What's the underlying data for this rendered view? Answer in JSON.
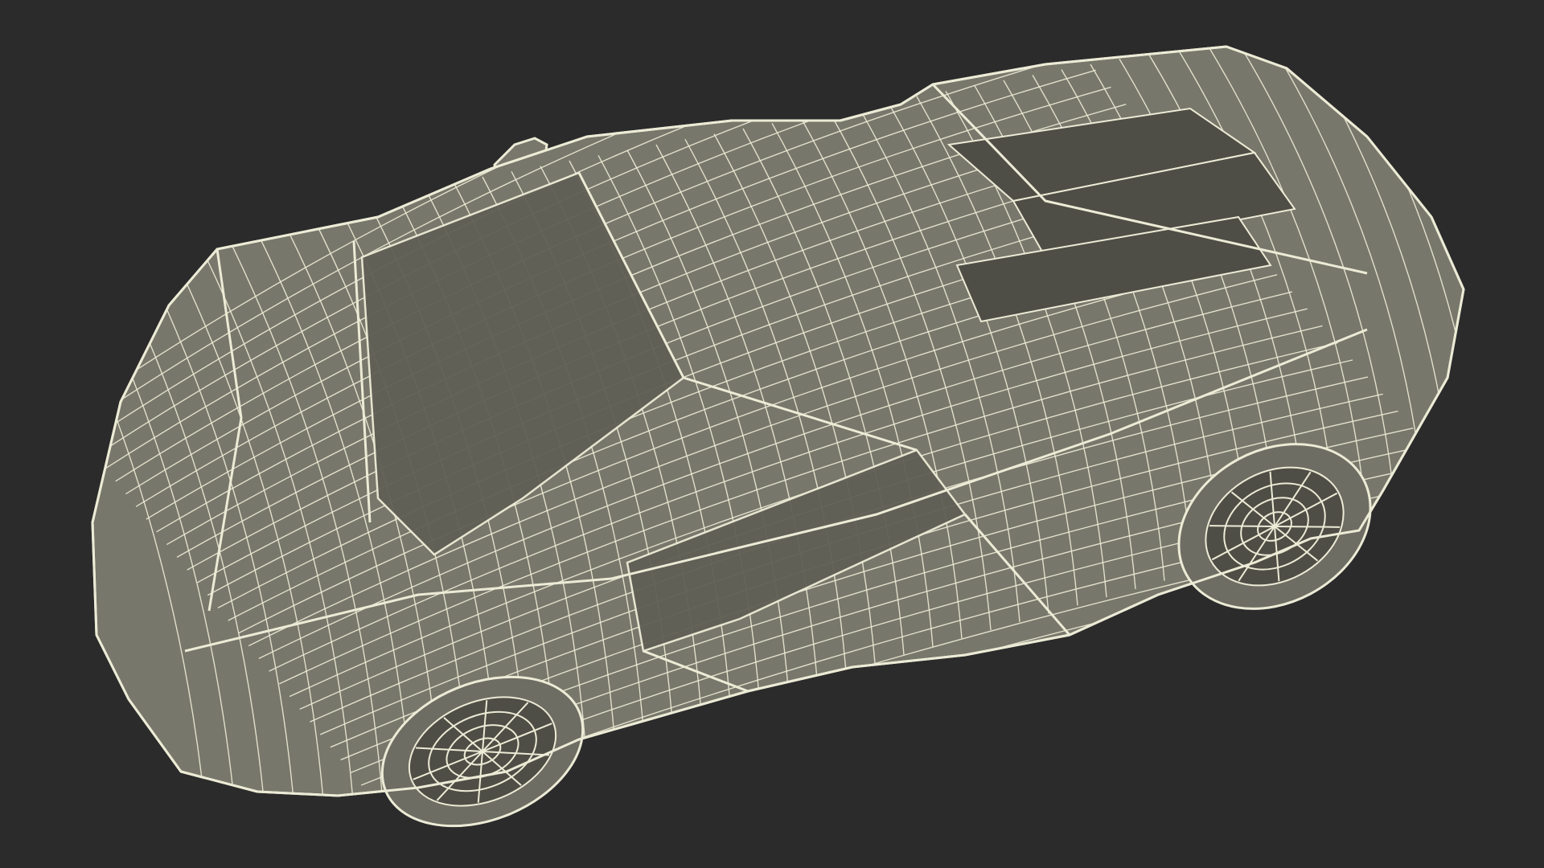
{
  "scene": {
    "subject": "car-wireframe-render",
    "colors": {
      "background": "#2b2b2b",
      "body": "#77776b",
      "body_dark": "#5f5f55",
      "body_shadow": "#4e4e46",
      "wire": "#ecebd6",
      "tire": "#6d6d63"
    }
  }
}
